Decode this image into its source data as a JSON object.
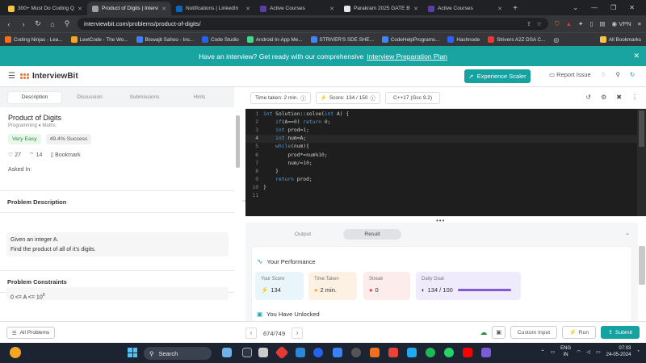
{
  "browser": {
    "tabs": [
      {
        "title": "300+ Must Do Coding Questio",
        "color": "#f6c343",
        "active": false
      },
      {
        "title": "Product of Digits | Intervie",
        "color": "#9aa0a6",
        "active": true
      },
      {
        "title": "Notifications | LinkedIn",
        "color": "#0a66c2",
        "active": false
      },
      {
        "title": "Active Courses",
        "color": "#5b3ea8",
        "active": false
      },
      {
        "title": "Parakram 2025 GATE Batch C",
        "color": "#e8e8e8",
        "active": false
      },
      {
        "title": "Active Courses",
        "color": "#5b3ea8",
        "active": false
      }
    ],
    "url": "interviewbit.com/problems/product-of-digits/",
    "vpn_label": "VPN",
    "bookmarks": [
      {
        "label": "Coding Ninjas - Lea...",
        "color": "#f37021"
      },
      {
        "label": "LeetCode - The Wo...",
        "color": "#f6a623"
      },
      {
        "label": "Biswajit Sahoo - Ins...",
        "color": "#3b82f6"
      },
      {
        "label": "Code Studio",
        "color": "#2563eb"
      },
      {
        "label": "Android In-App Me...",
        "color": "#3ddc84"
      },
      {
        "label": "STRIVER'S SDE SHE...",
        "color": "#4285f4"
      },
      {
        "label": "CodeHelpPrograms...",
        "color": "#4285f4"
      },
      {
        "label": "Hashnode",
        "color": "#2962ff"
      },
      {
        "label": "Strivers A2Z DSA C...",
        "color": "#e53935"
      }
    ],
    "all_bookmarks_label": "All Bookmarks"
  },
  "banner": {
    "text": "Have an interview? Get ready with our comprehensive",
    "link": "Interview Preparation Plan"
  },
  "header": {
    "logo": "InterviewBit",
    "experience_button": "Experience Scaler",
    "report_issue": "Report Issue"
  },
  "left": {
    "tabs": [
      "Description",
      "Discussion",
      "Submissions",
      "Hints"
    ],
    "title": "Product of Digits",
    "tags": "Programming ♦ Maths",
    "difficulty": "Very Easy",
    "success": "49.4% Success",
    "likes": "27",
    "dislikes": "14",
    "bookmark": "Bookmark",
    "asked_in": "Asked In:",
    "description_heading": "Problem Description",
    "description_lines": [
      "Given an integer A.",
      "Find the product of all of it's digits."
    ],
    "constraints_heading": "Problem Constraints",
    "constraint_prefix": "0 <= A <= 10",
    "constraint_exponent": "9"
  },
  "editor_bar": {
    "time_label": "Time taken: 2 min.",
    "score_label": "Score:  134  /  150",
    "language": "C++17 (Gcc 9.2)"
  },
  "code_lines": [
    "int Solution::solve(int A) {",
    "    if(A==0) return 0;",
    "    int prod=1;",
    "    int num=A;",
    "    while(num){",
    "        prod*=num%10;",
    "        num/=10;",
    "    }",
    "    return prod;",
    "}",
    ""
  ],
  "result": {
    "tabs": [
      "Output",
      "Result"
    ],
    "performance_label": "Your Performance",
    "cards": [
      {
        "label": "Your Score",
        "value": "134",
        "bg": "#e8f6fb",
        "icon_color": "#14a3a0"
      },
      {
        "label": "Time Taken",
        "value": "2 min.",
        "bg": "#fdf1e3",
        "icon_color": "#f5a623"
      },
      {
        "label": "Streak",
        "value": "0",
        "bg": "#fdecec",
        "icon_color": "#e53935"
      },
      {
        "label": "Daily Goal",
        "value": "134 / 100",
        "bg": "#efeafc",
        "icon_color": "#333"
      }
    ],
    "daily_goal_progress": 1.0,
    "unlocked_label": "You Have Unlocked"
  },
  "bottom": {
    "all_problems": "All Problems",
    "page_indicator": "674/749",
    "custom_input": "Custom Input",
    "run": "Run",
    "submit": "Submit"
  },
  "taskbar": {
    "search": "Search",
    "lang_line1": "ENG",
    "lang_line2": "IN",
    "time": "07:03",
    "date": "24-05-2024"
  }
}
